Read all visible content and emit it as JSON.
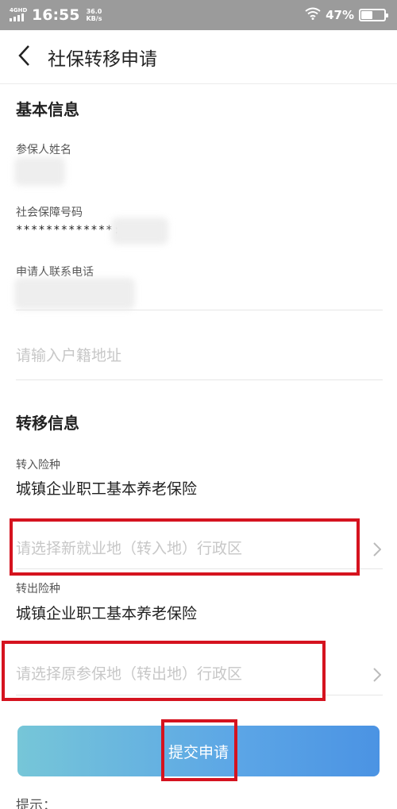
{
  "status_bar": {
    "network": "4GHD",
    "time": "16:55",
    "speed_value": "36.0",
    "speed_unit": "KB/s",
    "battery": "47%",
    "battery_level": 0.47
  },
  "header": {
    "title": "社保转移申请"
  },
  "basic_info": {
    "section_title": "基本信息",
    "name_label": "参保人姓名",
    "ssn_label": "社会保障号码",
    "ssn_value": "*************:",
    "phone_label": "申请人联系电话",
    "address_placeholder": "请输入户籍地址"
  },
  "transfer_info": {
    "section_title": "转移信息",
    "in_type_label": "转入险种",
    "in_type_value": "城镇企业职工基本养老保险",
    "in_region_placeholder": "请选择新就业地（转入地）行政区",
    "out_type_label": "转出险种",
    "out_type_value": "城镇企业职工基本养老保险",
    "out_region_placeholder": "请选择原参保地（转出地）行政区"
  },
  "submit_label": "提交申请",
  "hint_label": "提示：",
  "colors": {
    "highlight_red": "#d5131f",
    "button_start": "#76c6d8",
    "button_end": "#4b93e3"
  }
}
